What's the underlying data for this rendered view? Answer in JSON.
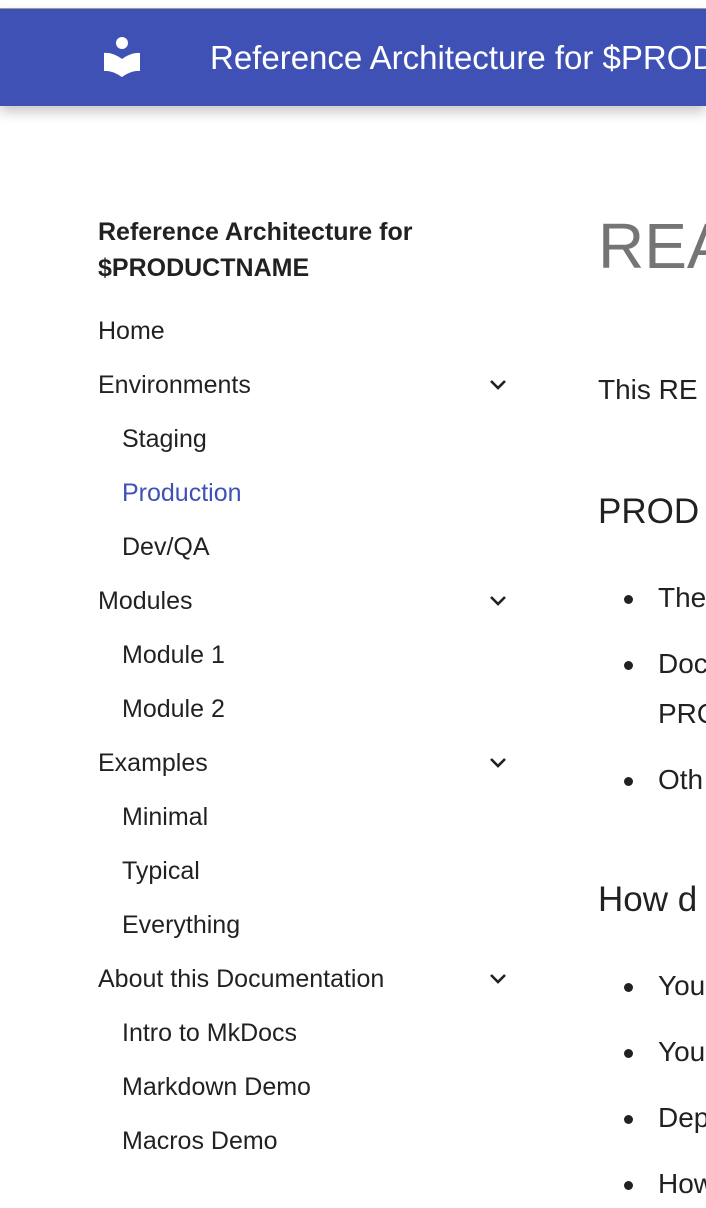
{
  "header": {
    "title": "Reference Architecture for $PRODUCTNAME",
    "logo_icon": "book-reader-icon",
    "color": "#3f51b5"
  },
  "nav": {
    "title": "Reference Architecture for $PRODUCTNAME",
    "items": [
      {
        "label": "Home"
      },
      {
        "label": "Environments",
        "expandable": true
      },
      {
        "label": "Staging"
      },
      {
        "label": "Production",
        "active": true
      },
      {
        "label": "Dev/QA"
      },
      {
        "label": "Modules",
        "expandable": true
      },
      {
        "label": "Module 1"
      },
      {
        "label": "Module 2"
      },
      {
        "label": "Examples",
        "expandable": true
      },
      {
        "label": "Minimal"
      },
      {
        "label": "Typical"
      },
      {
        "label": "Everything"
      },
      {
        "label": "About this Documentation",
        "expandable": true
      },
      {
        "label": "Intro to MkDocs"
      },
      {
        "label": "Markdown Demo"
      },
      {
        "label": "Macros Demo"
      }
    ],
    "active_color": "#3f51b5"
  },
  "content": {
    "h1": "REA",
    "intro": "This RE",
    "sections": [
      {
        "heading": "PROD",
        "bullets": [
          "The",
          "Doc",
          "Oth"
        ],
        "continuation": "PRO"
      },
      {
        "heading": "How d",
        "bullets": [
          "You",
          "You",
          "Dep",
          "How"
        ]
      }
    ]
  }
}
